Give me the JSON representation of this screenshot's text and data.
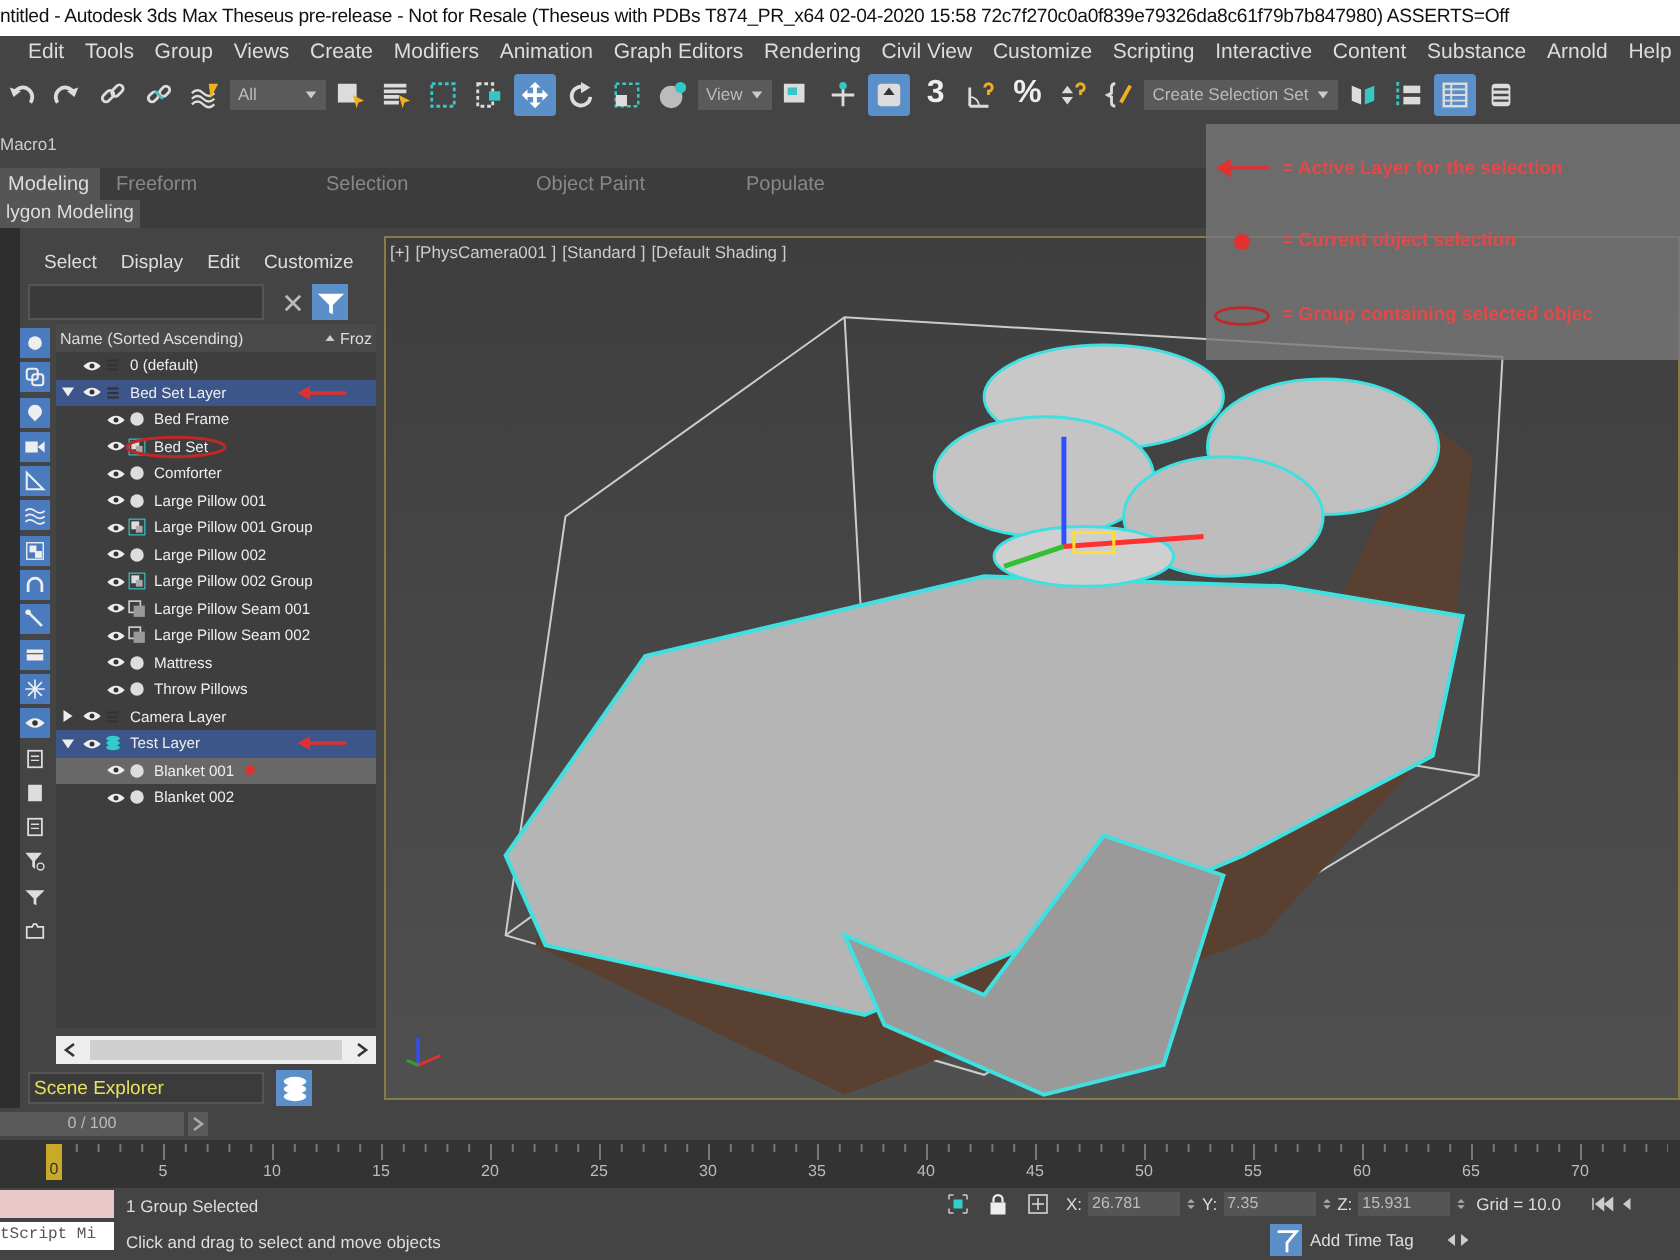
{
  "window": {
    "title": "ntitled - Autodesk 3ds Max Theseus pre-release - Not for Resale (Theseus with PDBs T874_PR_x64 02-04-2020 15:58 72c7f270c0a0f839e79326da8c61f79b7b847980) ASSERTS=Off"
  },
  "menu": [
    "Edit",
    "Tools",
    "Group",
    "Views",
    "Create",
    "Modifiers",
    "Animation",
    "Graph Editors",
    "Rendering",
    "Civil View",
    "Customize",
    "Scripting",
    "Interactive",
    "Content",
    "Substance",
    "Arnold",
    "Help"
  ],
  "toolbar": [
    {
      "kind": "tool",
      "on": false
    },
    {
      "kind": "tool",
      "on": false
    },
    {
      "kind": "tool",
      "on": false
    },
    {
      "kind": "tool",
      "on": false
    },
    {
      "kind": "tool",
      "on": false
    },
    {
      "kind": "dropdown",
      "value": "All"
    },
    {
      "kind": "tool",
      "on": false
    },
    {
      "kind": "tool",
      "on": false
    },
    {
      "kind": "tool",
      "on": false
    },
    {
      "kind": "tool",
      "on": false
    },
    {
      "kind": "tool",
      "on": true
    },
    {
      "kind": "tool",
      "on": false
    },
    {
      "kind": "tool",
      "on": false
    },
    {
      "kind": "tool",
      "on": false
    },
    {
      "kind": "dropdown",
      "value": "View"
    },
    {
      "kind": "tool",
      "on": false
    },
    {
      "kind": "tool",
      "on": false
    },
    {
      "kind": "tool",
      "on": true
    },
    {
      "kind": "glyph",
      "text": "3"
    },
    {
      "kind": "tool",
      "on": false
    },
    {
      "kind": "glyph",
      "text": "%"
    },
    {
      "kind": "tool",
      "on": false
    },
    {
      "kind": "tool",
      "on": false
    },
    {
      "kind": "dropdown",
      "value": "Create Selection Set"
    },
    {
      "kind": "tool",
      "on": false
    },
    {
      "kind": "tool",
      "on": false
    },
    {
      "kind": "tool",
      "on": true
    },
    {
      "kind": "tool",
      "on": false
    }
  ],
  "macro": "Macro1",
  "ribbon": {
    "tabs": [
      {
        "label": "Modeling",
        "selected": true
      },
      {
        "label": "Freeform",
        "selected": false
      },
      {
        "label": "Selection",
        "selected": false
      },
      {
        "label": "Object Paint",
        "selected": false
      },
      {
        "label": "Populate",
        "selected": false
      }
    ],
    "panel": "lygon Modeling"
  },
  "legend": [
    {
      "kind": "arrow",
      "text": "= Active Layer for the selection"
    },
    {
      "kind": "dot",
      "text": "= Current object selection"
    },
    {
      "kind": "oval",
      "text": "= Group containing selected objec"
    }
  ],
  "explorer": {
    "menu": [
      "Select",
      "Display",
      "Edit",
      "Customize"
    ],
    "filters": [
      {
        "on": true
      },
      {
        "on": true
      },
      {
        "on": true
      },
      {
        "on": true
      },
      {
        "on": true
      },
      {
        "on": true
      },
      {
        "on": true
      },
      {
        "on": true
      },
      {
        "on": true
      },
      {
        "on": true
      },
      {
        "on": true
      },
      {
        "on": true
      },
      {
        "on": false
      },
      {
        "on": false
      },
      {
        "on": false
      },
      {
        "on": false
      },
      {
        "on": false
      },
      {
        "on": false
      }
    ],
    "columns": [
      "Name (Sorted Ascending)",
      "Froz"
    ],
    "tree": [
      {
        "name": "0 (default)",
        "kind": "layer",
        "active": false,
        "selected": false
      },
      {
        "name": "Bed Set Layer",
        "kind": "layer",
        "active": true,
        "selected": false,
        "expanded": true,
        "arrow": true,
        "children": [
          {
            "name": "Bed Frame",
            "kind": "object",
            "selected": false
          },
          {
            "name": "Bed Set",
            "kind": "group",
            "selected": false,
            "circled": true
          },
          {
            "name": "Comforter",
            "kind": "object",
            "selected": false
          },
          {
            "name": "Large Pillow 001",
            "kind": "object",
            "selected": false
          },
          {
            "name": "Large Pillow 001 Group",
            "kind": "group",
            "selected": false
          },
          {
            "name": "Large Pillow 002",
            "kind": "object",
            "selected": false
          },
          {
            "name": "Large Pillow 002 Group",
            "kind": "group",
            "selected": false
          },
          {
            "name": "Large Pillow Seam 001",
            "kind": "shape",
            "selected": false
          },
          {
            "name": "Large Pillow Seam 002",
            "kind": "shape",
            "selected": false
          },
          {
            "name": "Mattress",
            "kind": "object",
            "selected": false
          },
          {
            "name": "Throw Pillows",
            "kind": "object",
            "selected": false
          }
        ]
      },
      {
        "name": "Camera Layer",
        "kind": "layer",
        "active": false,
        "selected": false,
        "expanded": false
      },
      {
        "name": "Test Layer",
        "kind": "current",
        "active": true,
        "selected": false,
        "expanded": true,
        "arrow": true,
        "children": [
          {
            "name": "Blanket 001",
            "kind": "object",
            "selected": true,
            "dot": true
          },
          {
            "name": "Blanket 002",
            "kind": "object",
            "selected": false
          }
        ]
      }
    ],
    "mode": "Scene Explorer"
  },
  "viewport": {
    "labels": [
      "[+]",
      "[PhysCamera001 ]",
      "[Standard ]",
      "[Default Shading ]"
    ]
  },
  "timeline": {
    "frame_counter": "0 / 100",
    "level": 0,
    "current_frame": "0",
    "ruler_labels": [
      "5",
      "10",
      "15",
      "20",
      "25",
      "30",
      "35",
      "40",
      "45",
      "50",
      "55",
      "60",
      "65",
      "70"
    ]
  },
  "status": {
    "listener": "tScript Mi",
    "selection": "1 Group Selected",
    "prompt": "Click and drag to select and move objects",
    "coords": [
      {
        "label": "X:",
        "value": "26.781"
      },
      {
        "label": "Y:",
        "value": "7.35"
      },
      {
        "label": "Z:",
        "value": "15.931"
      }
    ],
    "grid": "Grid = 10.0",
    "time_tag": "Add Time Tag"
  }
}
